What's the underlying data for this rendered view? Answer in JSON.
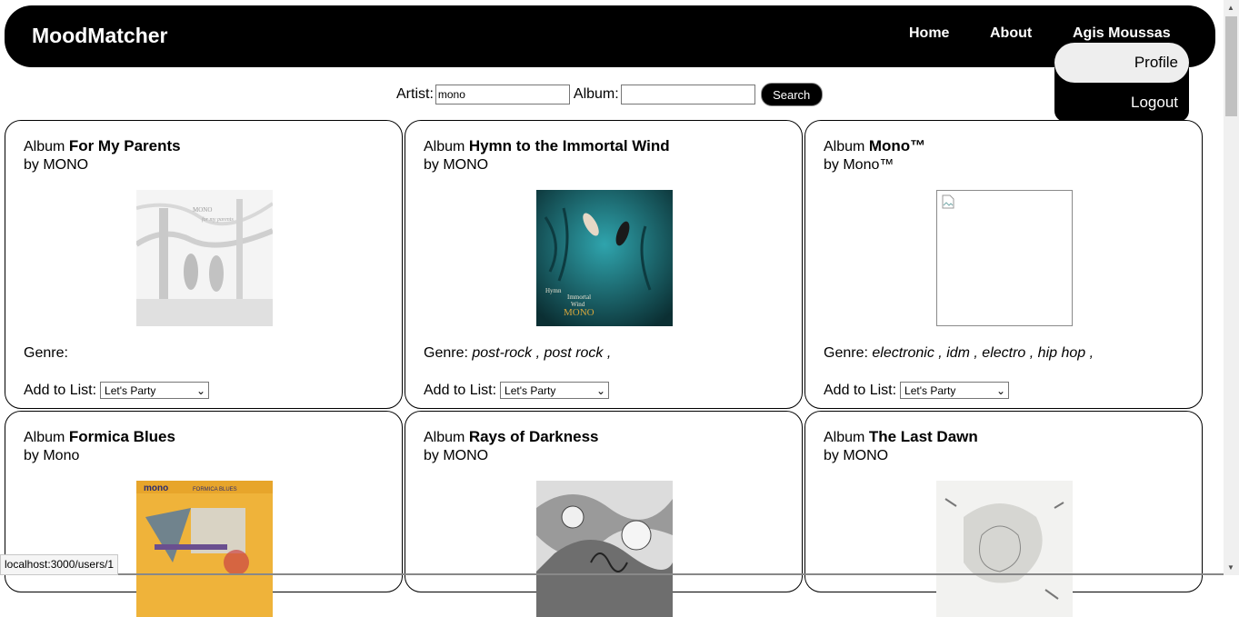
{
  "navbar": {
    "brand": "MoodMatcher",
    "links": [
      "Home",
      "About",
      "Agis Moussas"
    ],
    "dropdown": {
      "profile": "Profile",
      "logout": "Logout"
    }
  },
  "search": {
    "artist_label": "Artist:",
    "artist_value": "mono",
    "album_label": "Album:",
    "album_value": "",
    "button": "Search"
  },
  "cards": [
    {
      "prefix": "Album",
      "title": "For My Parents",
      "by": "by MONO",
      "genre_label": "Genre:",
      "genres": "",
      "add_label": "Add to List:",
      "list_value": "Let's Party"
    },
    {
      "prefix": "Album",
      "title": "Hymn to the Immortal Wind",
      "by": "by MONO",
      "genre_label": "Genre:",
      "genres": "post-rock , post rock ,",
      "add_label": "Add to List:",
      "list_value": "Let's Party"
    },
    {
      "prefix": "Album",
      "title": "Mono™",
      "by": "by Mono™",
      "genre_label": "Genre:",
      "genres": "electronic , idm , electro , hip hop ,",
      "add_label": "Add to List:",
      "list_value": "Let's Party"
    },
    {
      "prefix": "Album",
      "title": "Formica Blues",
      "by": "by Mono"
    },
    {
      "prefix": "Album",
      "title": "Rays of Darkness",
      "by": "by MONO"
    },
    {
      "prefix": "Album",
      "title": "The Last Dawn",
      "by": "by MONO"
    }
  ],
  "cover_art": {
    "c0_text": "MONO",
    "c0_sub": "for my parents",
    "c1_text": "Hymn to the Immortal Wind",
    "c1_band": "MONO",
    "c3_text": "mono",
    "c3_sub": "FORMICA BLUES"
  },
  "status_bar": "localhost:3000/users/1"
}
